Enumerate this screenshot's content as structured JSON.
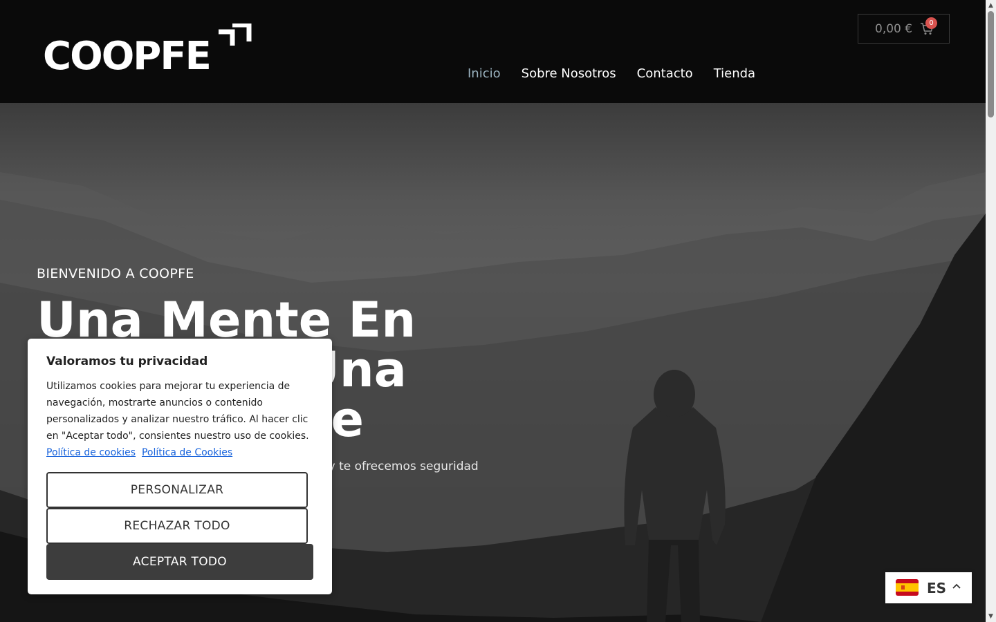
{
  "header": {
    "logo_text": "COOPFE",
    "nav": [
      {
        "label": "Inicio",
        "active": true
      },
      {
        "label": "Sobre Nosotros",
        "active": false
      },
      {
        "label": "Contacto",
        "active": false
      },
      {
        "label": "Tienda",
        "active": false
      }
    ],
    "cart": {
      "amount": "0,00 €",
      "count": "0",
      "icon": "shopping-cart-icon"
    }
  },
  "hero": {
    "kicker": "BIENVENIDO A COOPFE",
    "title": "Una Mente En Calma Es Una Mente Libre",
    "description": "Te acompañamos a cuidar de tu salud emocional y te ofrecemos seguridad en tu proceso de crecimiento personal"
  },
  "cookie_banner": {
    "title": "Valoramos tu privacidad",
    "text": "Utilizamos cookies para mejorar tu experiencia de navegación, mostrarte anuncios o contenido personalizados y analizar nuestro tráfico. Al hacer clic en \"Aceptar todo\", consientes nuestro uso de cookies.",
    "link1": "Política de cookies",
    "link2": "Política de Cookies",
    "customize_label": "PERSONALIZAR",
    "reject_label": "RECHAZAR TODO",
    "accept_label": "ACEPTAR TODO"
  },
  "language": {
    "code": "ES",
    "flag": "spain-flag-icon"
  },
  "colors": {
    "header_bg": "#0a0a0a",
    "nav_active": "#9bb3c0",
    "accept_bg": "#3d3d3d",
    "link": "#1863dc",
    "badge": "#d9534f"
  }
}
